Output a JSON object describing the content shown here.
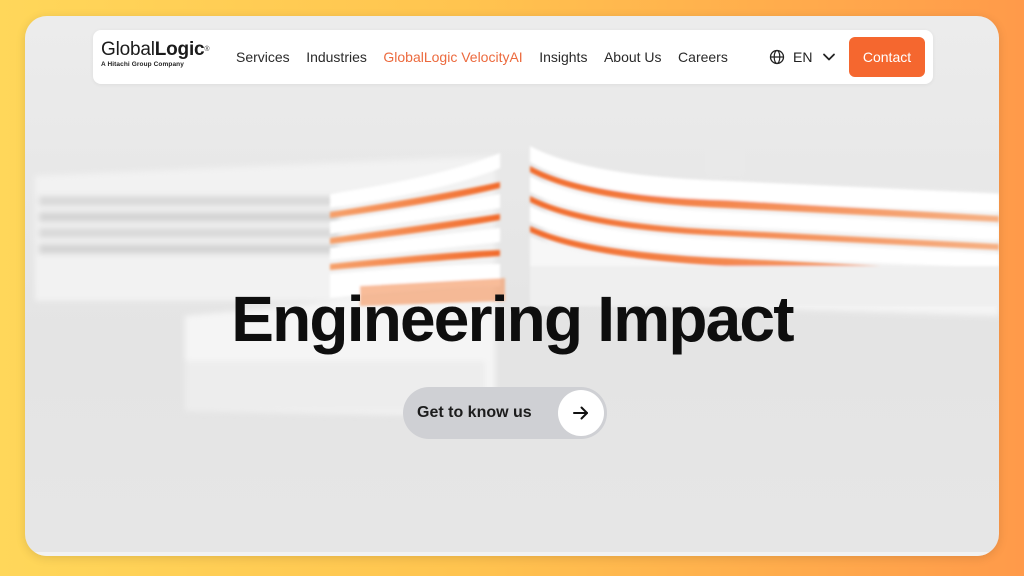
{
  "logo": {
    "name_regular": "Global",
    "name_bold": "Logic",
    "registered": "®",
    "tagline": "A Hitachi Group Company"
  },
  "nav": {
    "items": [
      {
        "label": "Services"
      },
      {
        "label": "Industries"
      },
      {
        "label": "GlobalLogic VelocityAI",
        "active": true
      },
      {
        "label": "Insights"
      },
      {
        "label": "About Us"
      },
      {
        "label": "Careers"
      }
    ],
    "language": {
      "label": "EN",
      "icon": "globe-icon",
      "chevron": "chevron-down-icon"
    },
    "contact_label": "Contact"
  },
  "hero": {
    "headline": "Engineering Impact",
    "cta_label": "Get to know us",
    "cta_icon": "arrow-right-icon"
  },
  "colors": {
    "accent": "#f5672f",
    "nav_active": "#ec6a3e",
    "background_gradient_start": "#ffd75a",
    "background_gradient_end": "#ff9a4a"
  }
}
